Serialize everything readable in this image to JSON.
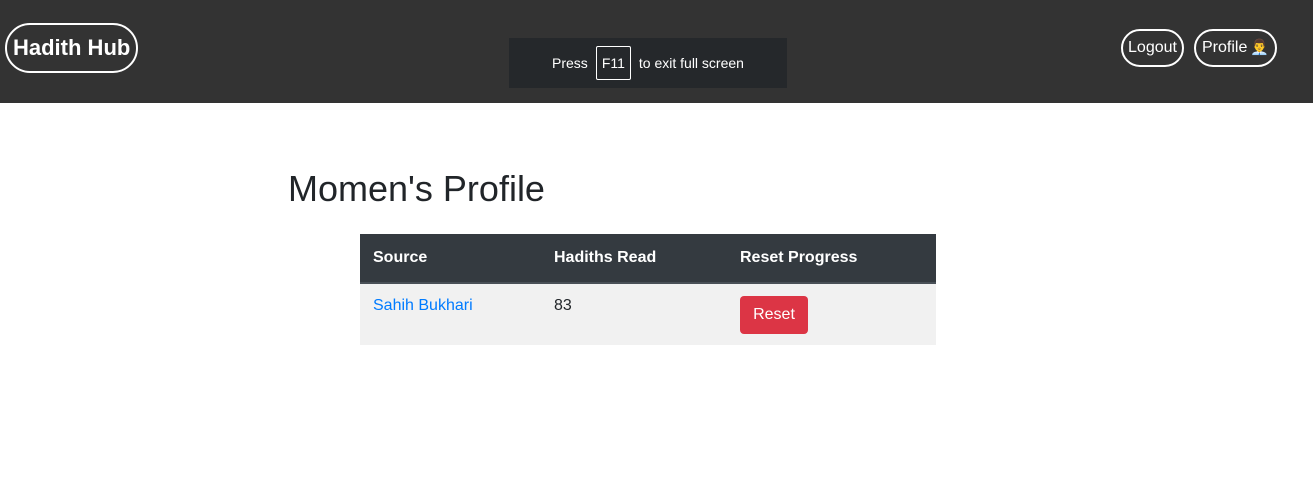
{
  "header": {
    "brand": "Hadith Hub",
    "logout_label": "Logout",
    "profile_label": "Profile",
    "profile_icons": "👨‍💼",
    "background": "#333333"
  },
  "fullscreen_notice": {
    "prefix": "Press",
    "key": "F11",
    "suffix": "to exit full screen"
  },
  "main": {
    "title": "Momen's Profile",
    "table": {
      "columns": [
        "Source",
        "Hadiths Read",
        "Reset Progress"
      ],
      "rows": [
        {
          "source": "Sahih Bukhari",
          "read": "83",
          "action_label": "Reset"
        }
      ]
    }
  },
  "colors": {
    "accent_link": "#007bff",
    "danger": "#dc3545",
    "table_header": "#343a40"
  }
}
